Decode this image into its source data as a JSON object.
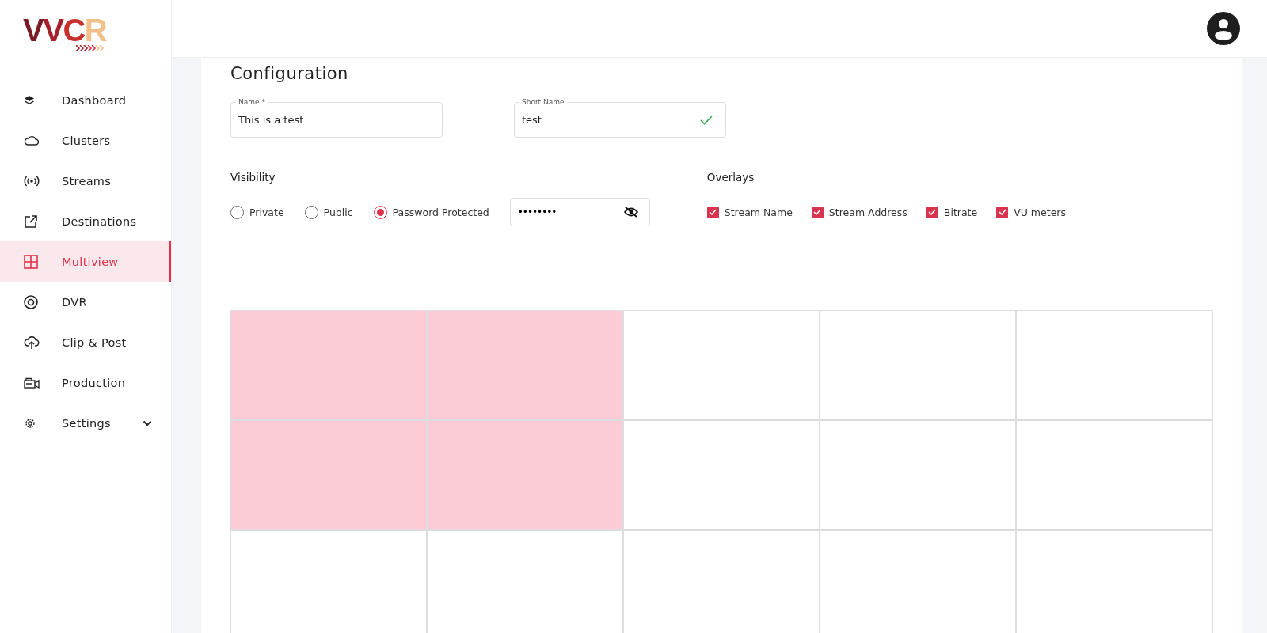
{
  "logo": {
    "text": "VVCR"
  },
  "sidebar": {
    "items": [
      {
        "label": "Dashboard",
        "selected": false
      },
      {
        "label": "Clusters",
        "selected": false
      },
      {
        "label": "Streams",
        "selected": false
      },
      {
        "label": "Destinations",
        "selected": false
      },
      {
        "label": "Multiview",
        "selected": true
      },
      {
        "label": "DVR",
        "selected": false
      },
      {
        "label": "Clip & Post",
        "selected": false
      },
      {
        "label": "Production",
        "selected": false
      },
      {
        "label": "Settings",
        "selected": false,
        "expandable": true
      }
    ]
  },
  "configuration": {
    "title": "Configuration",
    "fields": [
      {
        "label": "Name *",
        "value": "This is a test",
        "valid": false
      },
      {
        "label": "Short Name",
        "value": "test",
        "valid": true
      }
    ],
    "visibility": {
      "title": "Visibility",
      "options": [
        {
          "label": "Private",
          "selected": false
        },
        {
          "label": "Public",
          "selected": false
        },
        {
          "label": "Password Protected",
          "selected": true
        }
      ],
      "password": "••••••••"
    },
    "overlays": {
      "title": "Overlays",
      "options": [
        {
          "label": "Stream Name",
          "checked": true
        },
        {
          "label": "Stream Address",
          "checked": true
        },
        {
          "label": "Bitrate",
          "checked": true
        },
        {
          "label": "VU meters",
          "checked": true
        }
      ]
    }
  },
  "layout_grid": {
    "cells": [
      {
        "selected": true
      },
      {
        "selected": true
      },
      {
        "selected": false
      },
      {
        "selected": false
      },
      {
        "selected": false
      },
      {
        "selected": true
      },
      {
        "selected": true
      },
      {
        "selected": false
      },
      {
        "selected": false
      },
      {
        "selected": false
      },
      {
        "selected": false
      },
      {
        "selected": false
      },
      {
        "selected": false
      },
      {
        "selected": false
      },
      {
        "selected": false
      }
    ]
  }
}
